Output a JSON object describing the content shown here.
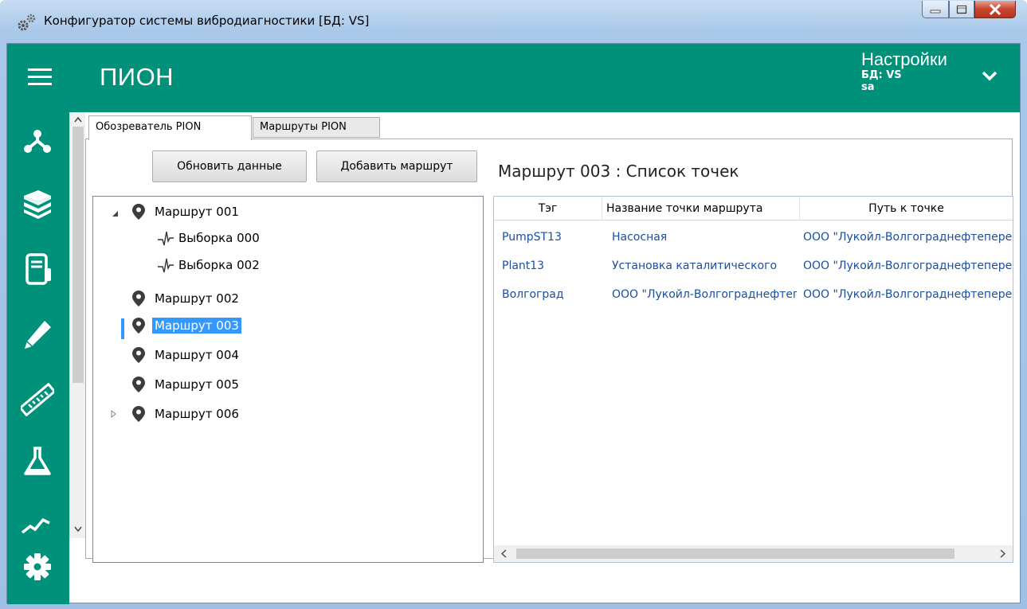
{
  "window": {
    "title": "Конфигуратор системы вибродиагностики [БД: VS]"
  },
  "appbar": {
    "title": "ПИОН",
    "settings_title": "Настройки",
    "db_line": "БД: VS",
    "user_line": "sa"
  },
  "nav": {
    "icons": [
      "hierarchy-icon",
      "books-icon",
      "cabinet-icon",
      "pencil-icon",
      "ruler-icon",
      "flask-icon",
      "trend-chart-icon",
      "gear-icon"
    ]
  },
  "tabs": [
    {
      "label": "Обозреватель PION",
      "active": true
    },
    {
      "label": "Маршруты PION",
      "active": false
    }
  ],
  "buttons": {
    "refresh": "Обновить данные",
    "add_route": "Добавить маршрут"
  },
  "tree": {
    "items": [
      {
        "label": "Маршрут 001",
        "expanded": true
      },
      {
        "label": "Выборка 000"
      },
      {
        "label": "Выборка 002"
      },
      {
        "label": "Маршрут 002"
      },
      {
        "label": "Маршрут 003",
        "selected": true
      },
      {
        "label": "Маршрут 004"
      },
      {
        "label": "Маршрут 005"
      },
      {
        "label": "Маршрут 006",
        "expanded": false
      }
    ]
  },
  "right": {
    "title": "Маршрут 003  :  Список точек",
    "columns": [
      "Тэг",
      "Название точки маршрута",
      "Путь к точке"
    ],
    "rows": [
      [
        "PumpST13",
        "Насосная",
        "ООО \"Лукойл-Волгограднефтепереработка\""
      ],
      [
        "Plant13",
        "Установка каталитического",
        "ООО \"Лукойл-Волгограднефтепереработка\""
      ],
      [
        "Волгоград",
        "ООО \"Лукойл-Волгограднефтепереработка\"",
        "ООО \"Лукойл-Волгограднефтепереработка\""
      ]
    ]
  },
  "colors": {
    "accent": "#00917a",
    "selection": "#3399ff",
    "grid_text": "#1a4fa0"
  }
}
